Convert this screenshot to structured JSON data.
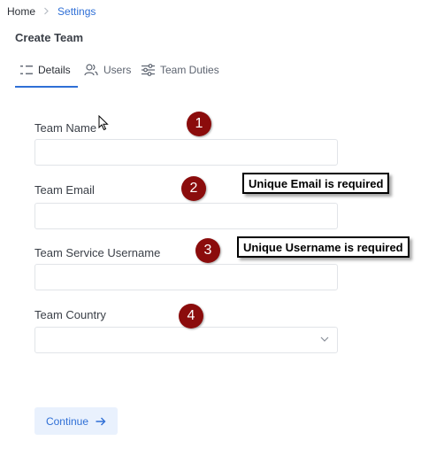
{
  "breadcrumb": {
    "home": "Home",
    "separator": ">",
    "current": "Settings"
  },
  "page": {
    "title": "Create Team"
  },
  "tabs": [
    {
      "label": "Details",
      "icon": "list-icon",
      "active": true
    },
    {
      "label": "Users",
      "icon": "users-icon",
      "active": false
    },
    {
      "label": "Team Duties",
      "icon": "sliders-icon",
      "active": false
    }
  ],
  "form": {
    "team_name": {
      "label": "Team Name",
      "value": ""
    },
    "team_email": {
      "label": "Team Email",
      "value": ""
    },
    "team_service_username": {
      "label": "Team Service Username",
      "value": ""
    },
    "team_country": {
      "label": "Team Country",
      "value": "",
      "icon": "chevron-down-icon"
    }
  },
  "annotations": {
    "markers": [
      "1",
      "2",
      "3",
      "4"
    ],
    "email_callout": "Unique Email is required",
    "username_callout": "Unique Username is required"
  },
  "actions": {
    "continue": "Continue",
    "continue_icon": "arrow-right-icon"
  },
  "colors": {
    "accent": "#2f6fd6",
    "marker": "#8b0c0c",
    "button_bg": "#e9f1fd"
  }
}
